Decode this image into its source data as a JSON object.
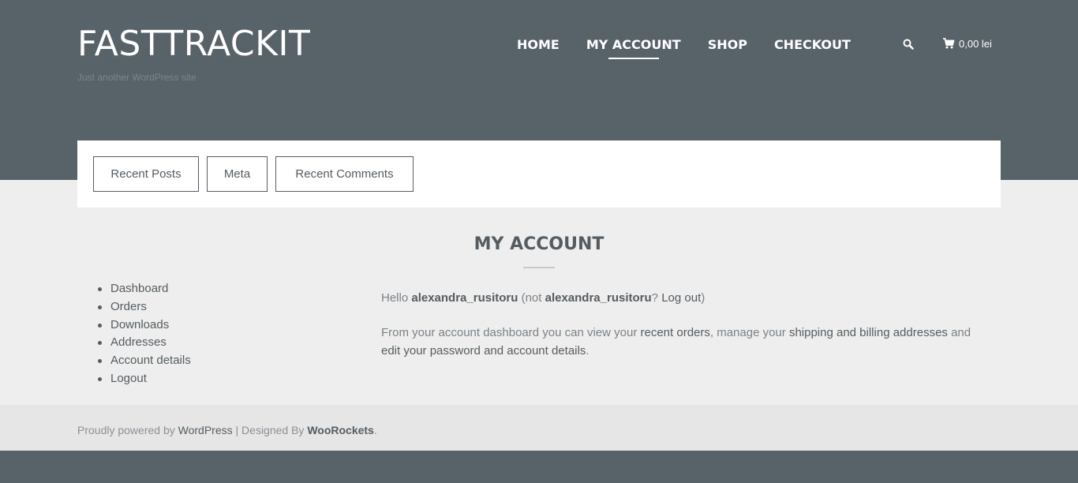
{
  "site": {
    "title": "FASTTRACKIT",
    "tagline": "Just another WordPress site"
  },
  "nav": {
    "items": [
      {
        "label": "HOME",
        "active": false
      },
      {
        "label": "MY ACCOUNT",
        "active": true
      },
      {
        "label": "SHOP",
        "active": false
      },
      {
        "label": "CHECKOUT",
        "active": false
      }
    ]
  },
  "header_tools": {
    "search_icon": "search-icon",
    "cart_icon": "cart-icon",
    "cart_total": "0,00 lei"
  },
  "widgets": {
    "buttons": [
      "Recent Posts",
      "Meta",
      "Recent Comments"
    ]
  },
  "page": {
    "title": "MY ACCOUNT"
  },
  "account_nav": {
    "items": [
      "Dashboard",
      "Orders",
      "Downloads",
      "Addresses",
      "Account details",
      "Logout"
    ]
  },
  "content": {
    "hello_prefix": "Hello ",
    "username": "alexandra_rusitoru",
    "not_prefix": " (not ",
    "username_2": "alexandra_rusitoru",
    "question": "? ",
    "logout_link": "Log out",
    "close_paren": ")",
    "dash_intro": "From your account dashboard you can view your ",
    "recent_orders_link": "recent orders",
    "dash_mid": ", manage your ",
    "addresses_link": "shipping and billing addresses",
    "dash_and": " and ",
    "account_details_link": "edit your password and account details",
    "dash_end": "."
  },
  "footer": {
    "powered_prefix": "Proudly powered by ",
    "wordpress_link": "WordPress",
    "separator": " | Designed By ",
    "designer": "WooRockets",
    "period": "."
  },
  "colors": {
    "header_bg": "#586269",
    "page_bg": "#eeeeee",
    "text_dark": "#555c61",
    "text_muted": "#7c8287"
  }
}
